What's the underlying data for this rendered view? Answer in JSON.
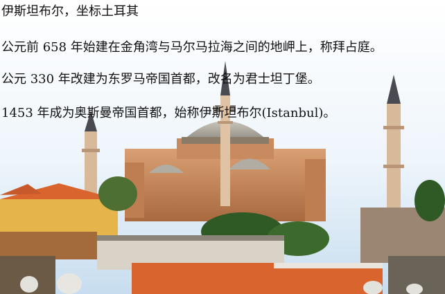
{
  "captions": [
    "伊斯坦布尔，坐标土耳其",
    "公元前 658 年始建在金角湾与马尔马拉海之间的地岬上，称拜占庭。",
    "公元 330 年改建为东罗马帝国首都，改名为君士坦丁堡。",
    "1453 年成为奥斯曼帝国首都，始称伊斯坦布尔(Istanbul)。"
  ],
  "colors": {
    "sky_top": "#ffffff",
    "sky_bottom": "#cfe3f5",
    "stone": "#c98a5c",
    "dome": "#a9a49a",
    "roof_orange": "#d9642e",
    "wall_yellow": "#e5b44a",
    "tree": "#2f5a26"
  }
}
